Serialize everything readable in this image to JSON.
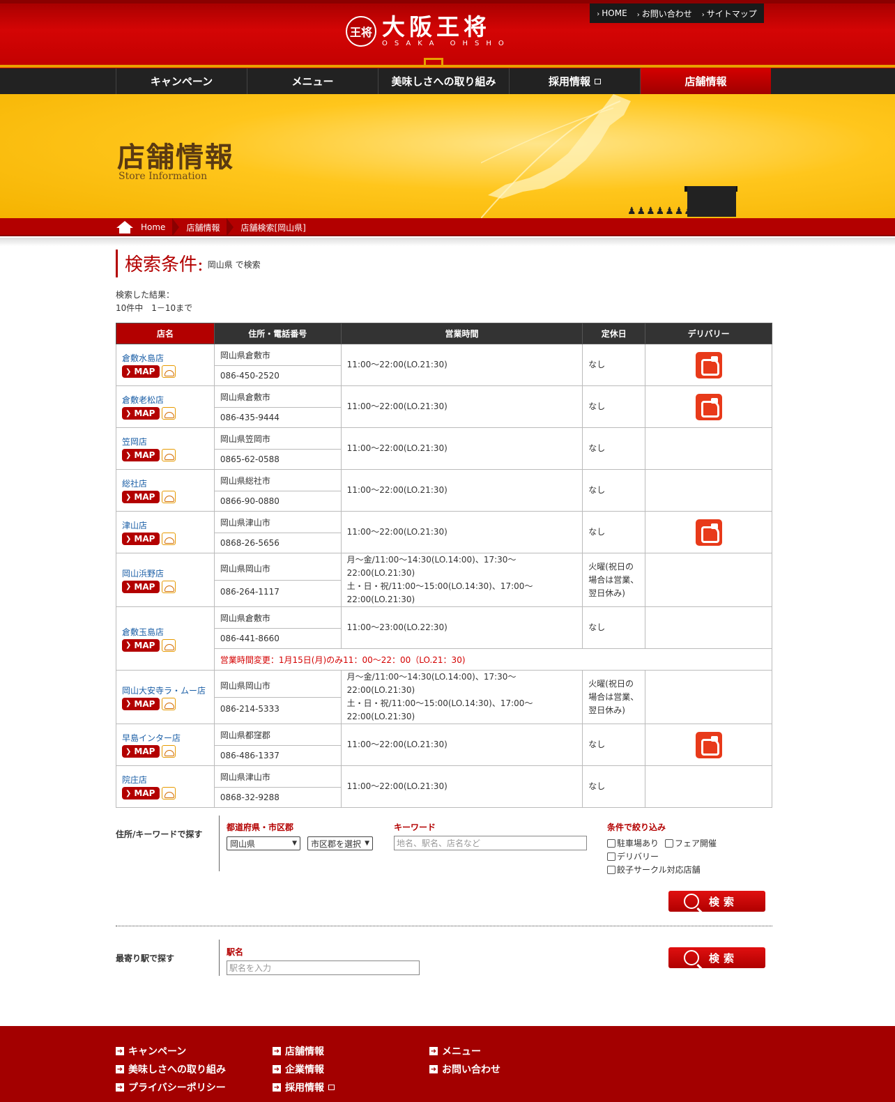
{
  "header": {
    "logo_text": "大阪王将",
    "logo_en": "OSAKA OHSHO",
    "logo_emblem": "王将",
    "util_links": [
      "HOME",
      "お問い合わせ",
      "サイトマップ"
    ]
  },
  "nav": {
    "items": [
      "キャンペーン",
      "メニュー",
      "美味しさへの取り組み",
      "採用情報",
      "店舗情報"
    ]
  },
  "hero": {
    "title": "店舗情報",
    "subtitle": "Store Information"
  },
  "breadcrumb": [
    "Home",
    "店舗情報",
    "店舗検索[岡山県]"
  ],
  "search_condition": {
    "title": "検索条件:",
    "value": "岡山県 で検索"
  },
  "result": {
    "line1": "検索した結果：",
    "line2": "10件中　1－10まで"
  },
  "table": {
    "headers": [
      "店名",
      "住所・電話番号",
      "営業時間",
      "定休日",
      "デリバリー"
    ],
    "map_label": "MAP",
    "rows": [
      {
        "name": "倉敷水島店",
        "address": "岡山県倉敷市",
        "phone": "086-450-2520",
        "hours": "11:00～22:00(LO.21:30)",
        "holiday": "なし",
        "delivery": true
      },
      {
        "name": "倉敷老松店",
        "address": "岡山県倉敷市",
        "phone": "086-435-9444",
        "hours": "11:00～22:00(LO.21:30)",
        "holiday": "なし",
        "delivery": true
      },
      {
        "name": "笠岡店",
        "address": "岡山県笠岡市",
        "phone": "0865-62-0588",
        "hours": "11:00～22:00(LO.21:30)",
        "holiday": "なし",
        "delivery": false
      },
      {
        "name": "総社店",
        "address": "岡山県総社市",
        "phone": "0866-90-0880",
        "hours": "11:00～22:00(LO.21:30)",
        "holiday": "なし",
        "delivery": false
      },
      {
        "name": "津山店",
        "address": "岡山県津山市",
        "phone": "0868-26-5656",
        "hours": "11:00～22:00(LO.21:30)",
        "holiday": "なし",
        "delivery": true
      },
      {
        "name": "岡山浜野店",
        "address": "岡山県岡山市",
        "phone": "086-264-1117",
        "hours": "月～金/11:00～14:30(LO.14:00)、17:30～22:00(LO.21:30)",
        "hours2": "土・日・祝/11:00～15:00(LO.14:30)、17:00～22:00(LO.21:30)",
        "holiday": "火曜(祝日の場合は営業、翌日休み)",
        "delivery": false
      },
      {
        "name": "倉敷玉島店",
        "address": "岡山県倉敷市",
        "phone": "086-441-8660",
        "hours": "11:00～23:00(LO.22:30)",
        "holiday": "なし",
        "delivery": false,
        "notice": "営業時間変更：1月15日(月)のみ11：00～22：00（LO.21：30)"
      },
      {
        "name": "岡山大安寺ラ・ムー店",
        "address": "岡山県岡山市",
        "phone": "086-214-5333",
        "hours": "月～金/11:00～14:30(LO.14:00)、17:30～22:00(LO.21:30)",
        "hours2": "土・日・祝/11:00～15:00(LO.14:30)、17:00～22:00(LO.21:30)",
        "holiday": "火曜(祝日の場合は営業、翌日休み)",
        "delivery": false
      },
      {
        "name": "早島インター店",
        "address": "岡山県都窪郡",
        "phone": "086-486-1337",
        "hours": "11:00～22:00(LO.21:30)",
        "holiday": "なし",
        "delivery": true
      },
      {
        "name": "院庄店",
        "address": "岡山県津山市",
        "phone": "0868-32-9288",
        "hours": "11:00～22:00(LO.21:30)",
        "holiday": "なし",
        "delivery": false
      }
    ]
  },
  "search_form": {
    "address_label": "住所/キーワードで探す",
    "pref_head": "都道府県・市区郡",
    "pref_value": "岡山県",
    "city_value": "市区郡を選択",
    "keyword_head": "キーワード",
    "keyword_placeholder": "地名、駅名、店名など",
    "filter_head": "条件で絞り込み",
    "filters": [
      "駐車場あり",
      "フェア開催",
      "デリバリー",
      "餃子サークル対応店舗"
    ],
    "search_label": "検索",
    "station_label": "最寄り駅で探す",
    "station_head": "駅名",
    "station_placeholder": "駅名を入力"
  },
  "footer": {
    "links": [
      "キャンペーン",
      "店舗情報",
      "メニュー",
      "美味しさへの取り組み",
      "企業情報",
      "お問い合わせ",
      "プライバシーポリシー",
      "採用情報"
    ]
  },
  "colors": {
    "brand_red": "#b30000",
    "accent_gold": "#ffc61c",
    "link_blue": "#1a5ea6"
  }
}
